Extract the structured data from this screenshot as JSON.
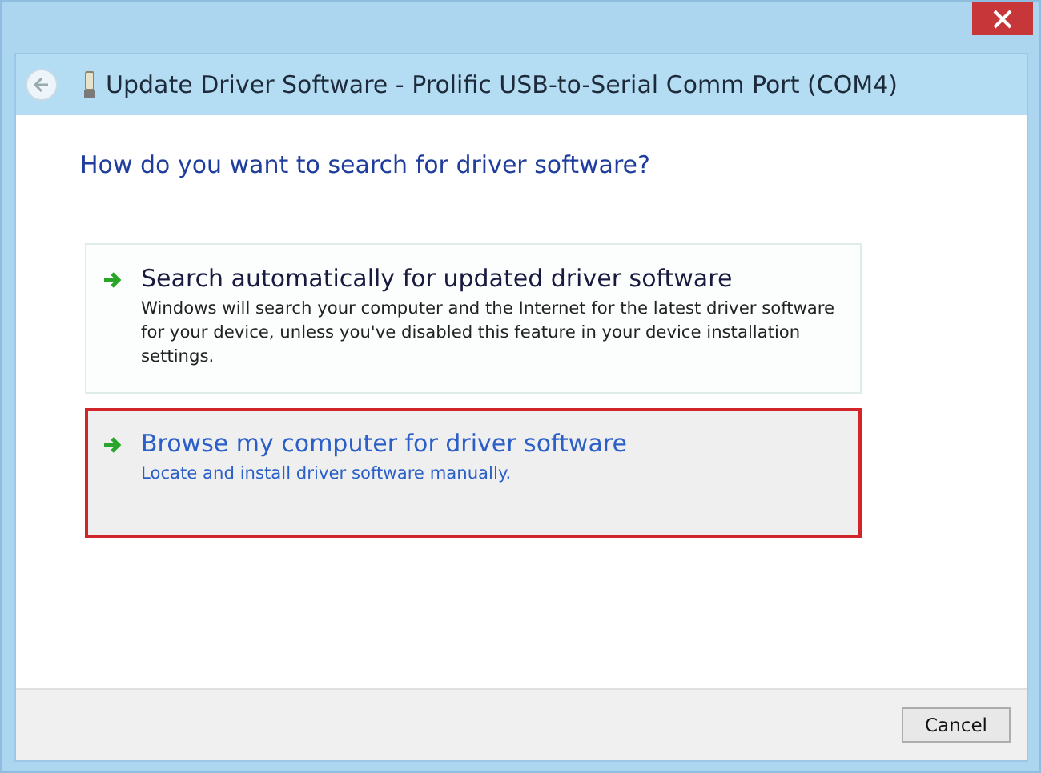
{
  "window": {
    "title": "Update Driver Software - Prolific USB-to-Serial Comm Port (COM4)"
  },
  "heading": "How do you want to search for driver software?",
  "options": [
    {
      "title": "Search automatically for updated driver software",
      "description": "Windows will search your computer and the Internet for the latest driver software for your device, unless you've disabled this feature in your device installation settings.",
      "selected": false
    },
    {
      "title": "Browse my computer for driver software",
      "description": "Locate and install driver software manually.",
      "selected": true
    }
  ],
  "buttons": [
    "Cancel"
  ]
}
